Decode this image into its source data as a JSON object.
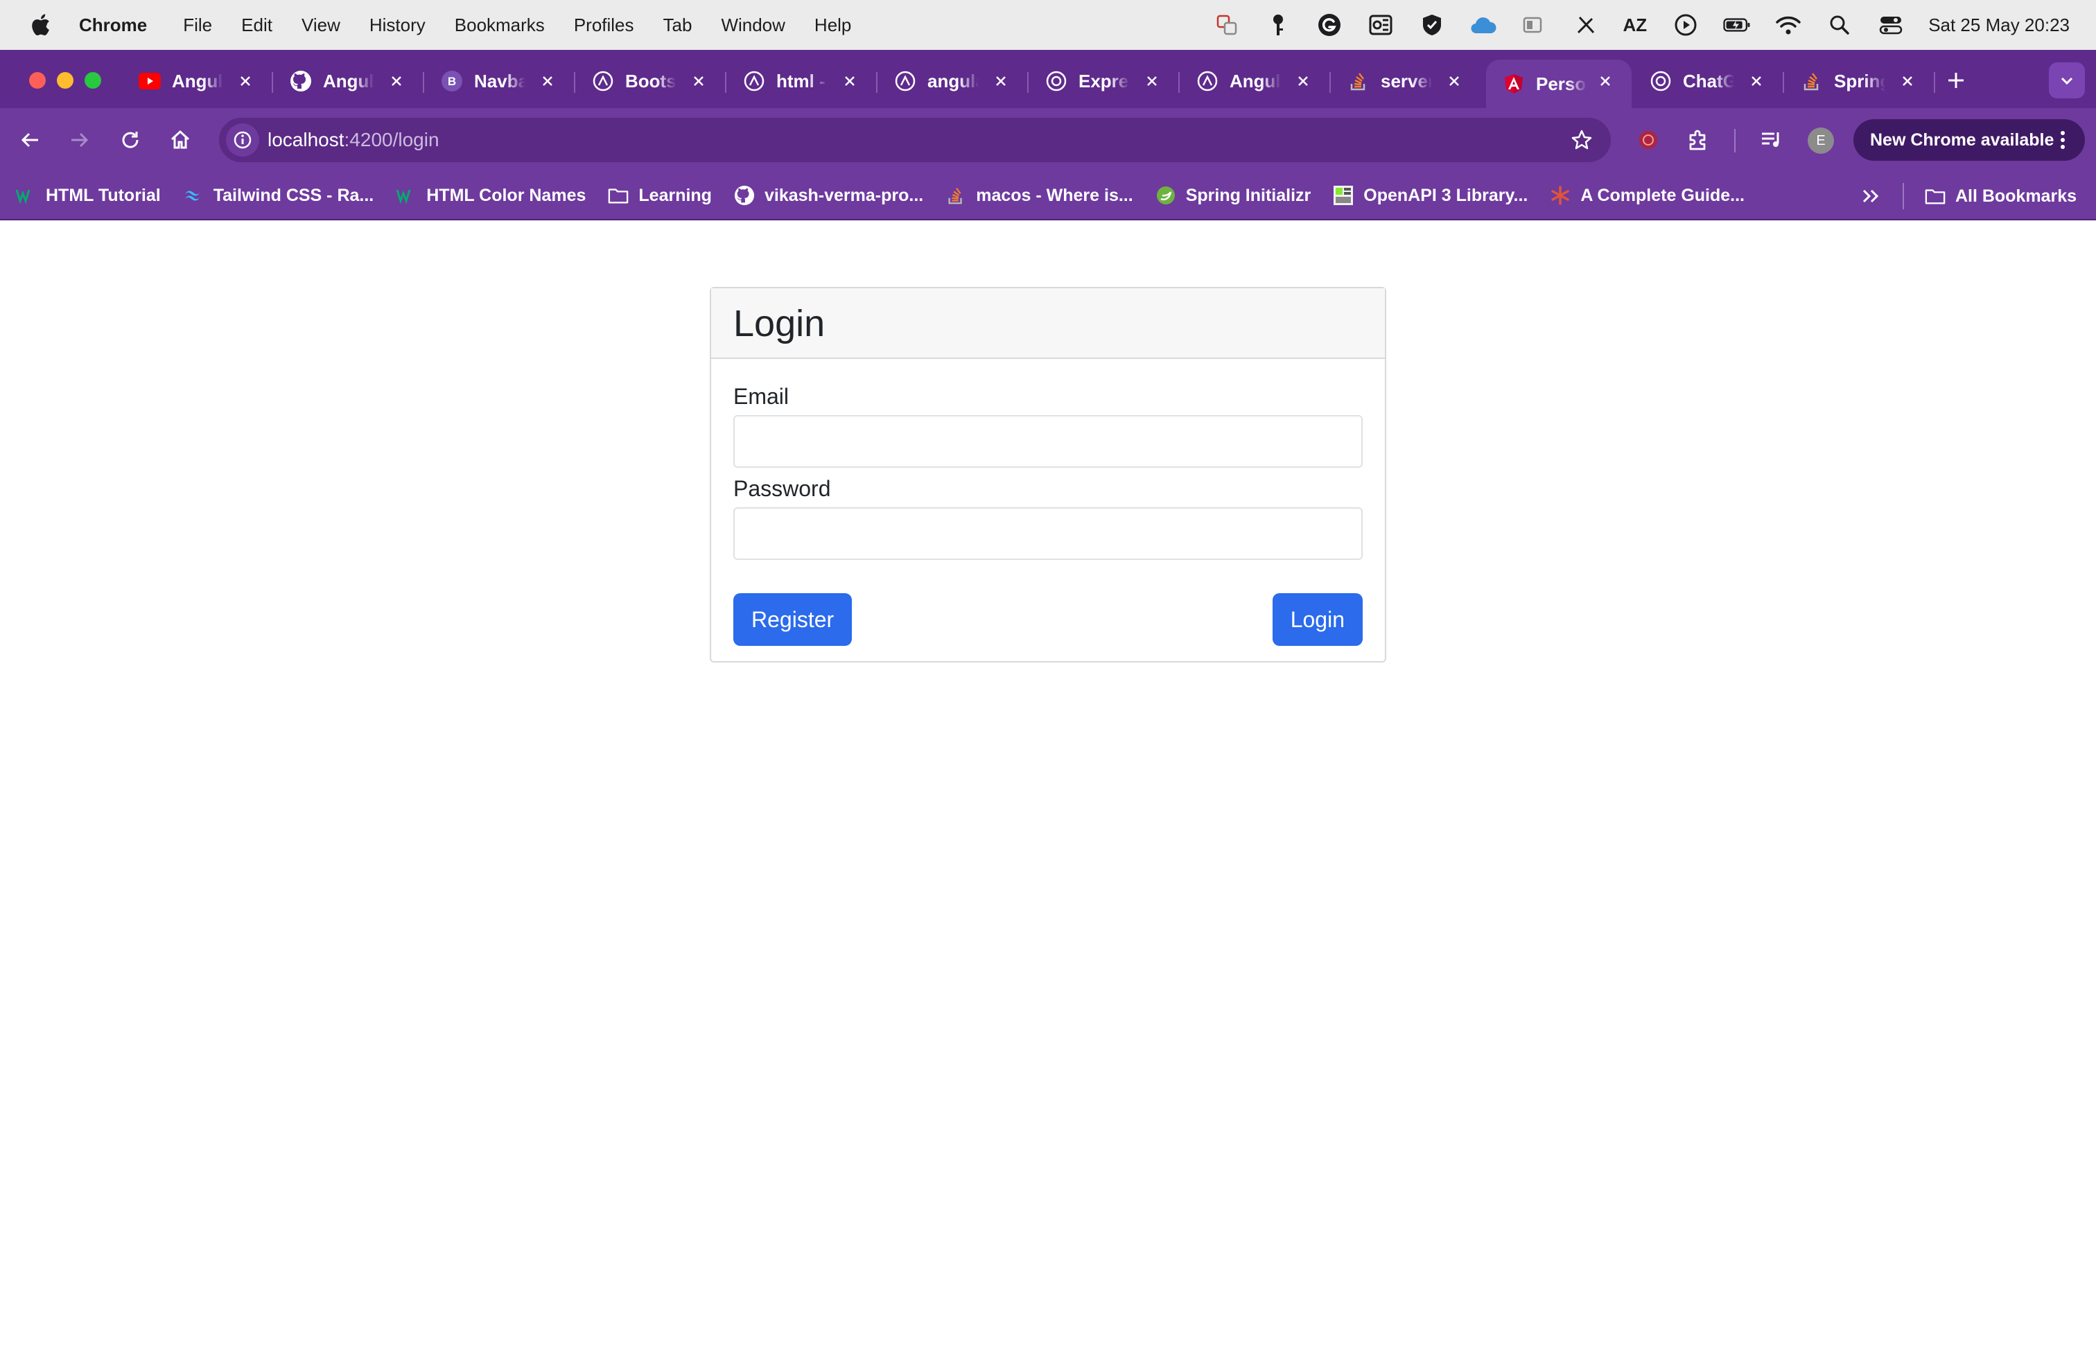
{
  "menubar": {
    "app_name": "Chrome",
    "items": [
      "File",
      "Edit",
      "View",
      "History",
      "Bookmarks",
      "Profiles",
      "Tab",
      "Window",
      "Help"
    ],
    "keyboard_layout": "AZ",
    "datetime": "Sat 25 May  20:23"
  },
  "tabs": [
    {
      "title": "Angular",
      "icon": "youtube-icon",
      "color": "#ff0000"
    },
    {
      "title": "Angular",
      "icon": "github-icon",
      "color": "#ffffff"
    },
    {
      "title": "Navbar",
      "icon": "bootstrap-icon",
      "color": "#7952b3"
    },
    {
      "title": "Bootstrap",
      "icon": "chatgpt-icon",
      "color": "#ffffff"
    },
    {
      "title": "html -",
      "icon": "chatgpt-icon",
      "color": "#ffffff"
    },
    {
      "title": "angular",
      "icon": "chatgpt-icon",
      "color": "#ffffff"
    },
    {
      "title": "Express",
      "icon": "openai-icon",
      "color": "#ffffff"
    },
    {
      "title": "Angular",
      "icon": "chatgpt-icon",
      "color": "#ffffff"
    },
    {
      "title": "server",
      "icon": "stackoverflow-icon",
      "color": "#f48024"
    },
    {
      "title": "Personal",
      "icon": "angular-icon",
      "color": "#dd0031",
      "active": true
    },
    {
      "title": "ChatGPT",
      "icon": "openai-icon",
      "color": "#ffffff"
    },
    {
      "title": "Spring",
      "icon": "stackoverflow-icon",
      "color": "#f48024"
    }
  ],
  "address_bar": {
    "host": "localhost",
    "path": ":4200/login"
  },
  "toolbar": {
    "profile_initial": "E",
    "update_label": "New Chrome available"
  },
  "bookmarks": {
    "items": [
      {
        "label": "HTML Tutorial",
        "icon": "w3schools-icon"
      },
      {
        "label": "Tailwind CSS - Ra...",
        "icon": "tailwind-icon"
      },
      {
        "label": "HTML Color Names",
        "icon": "w3schools-icon"
      },
      {
        "label": "Learning",
        "icon": "folder-icon"
      },
      {
        "label": "vikash-verma-pro...",
        "icon": "github-icon"
      },
      {
        "label": "macos - Where is...",
        "icon": "stackoverflow-icon"
      },
      {
        "label": "Spring Initializr",
        "icon": "spring-icon"
      },
      {
        "label": "OpenAPI 3 Library...",
        "icon": "openapi-icon"
      },
      {
        "label": "A Complete Guide...",
        "icon": "asterisk-icon"
      }
    ],
    "all_bookmarks_label": "All Bookmarks"
  },
  "login_form": {
    "title": "Login",
    "email_label": "Email",
    "email_value": "",
    "password_label": "Password",
    "password_value": "",
    "register_label": "Register",
    "login_label": "Login"
  },
  "colors": {
    "chrome_theme": "#6e3a9e",
    "tab_strip": "#5e2a8c",
    "primary_button": "#2b6bec"
  }
}
